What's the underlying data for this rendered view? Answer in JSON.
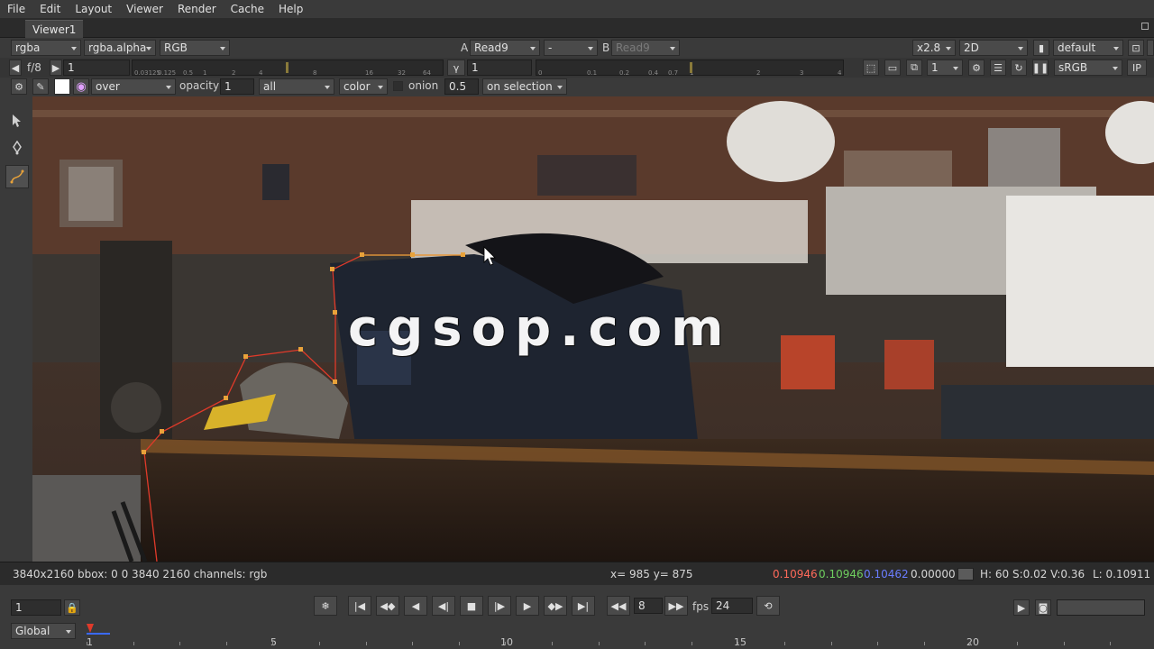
{
  "menu": [
    "File",
    "Edit",
    "Layout",
    "Viewer",
    "Render",
    "Cache",
    "Help"
  ],
  "tab": {
    "label": "Viewer1"
  },
  "toolbar1": {
    "channels": "rgba",
    "alpha": "rgba.alpha",
    "display": "RGB",
    "a_label": "A",
    "a_input": "Read9",
    "wipe_op": "-",
    "b_label": "B",
    "b_input": "Read9",
    "zoom": "x2.8",
    "view_mode": "2D",
    "lut": "default"
  },
  "toolbar2": {
    "fstop": "f/8",
    "gain": "1",
    "gamma_label": "γ",
    "gamma": "1",
    "gain_ticks": [
      "0.03125",
      "0.125",
      "0.5",
      "1",
      "2",
      "4",
      "8",
      "16",
      "32",
      "64"
    ],
    "gamma_ticks": [
      "0",
      "0.1",
      "0.2",
      "0.4",
      "0.7",
      "1",
      "2",
      "3",
      "4"
    ],
    "proxy": "1",
    "colorspace": "sRGB",
    "ip": "IP"
  },
  "toolbar3": {
    "composite": "over",
    "opacity_label": "opacity",
    "opacity": "1",
    "layer": "all",
    "color": "color",
    "onion_label": "onion",
    "onion": "0.5",
    "on_selection": "on selection"
  },
  "viewer": {
    "watermark": "cgsop.com"
  },
  "info": {
    "format": "3840x2160 bbox: 0 0 3840 2160 channels: rgb",
    "coords": "x= 985 y= 875",
    "r": "0.10946",
    "g": "0.10946",
    "b": "0.10462",
    "a": "0.00000",
    "hsv": "H: 60 S:0.02 V:0.36",
    "lum": "L: 0.10911"
  },
  "timebar": {
    "frame": "1",
    "step": "8",
    "fps_label": "fps",
    "fps": "24",
    "scope": "Global",
    "ticks": [
      "1",
      "5",
      "10",
      "15",
      "20"
    ]
  },
  "colors": {
    "accent_orange": "#e8a23a",
    "curve_red": "#e03a2a",
    "red_value": "#ff6a5a",
    "green_value": "#6fcf5f",
    "blue_value": "#6a7dff"
  }
}
